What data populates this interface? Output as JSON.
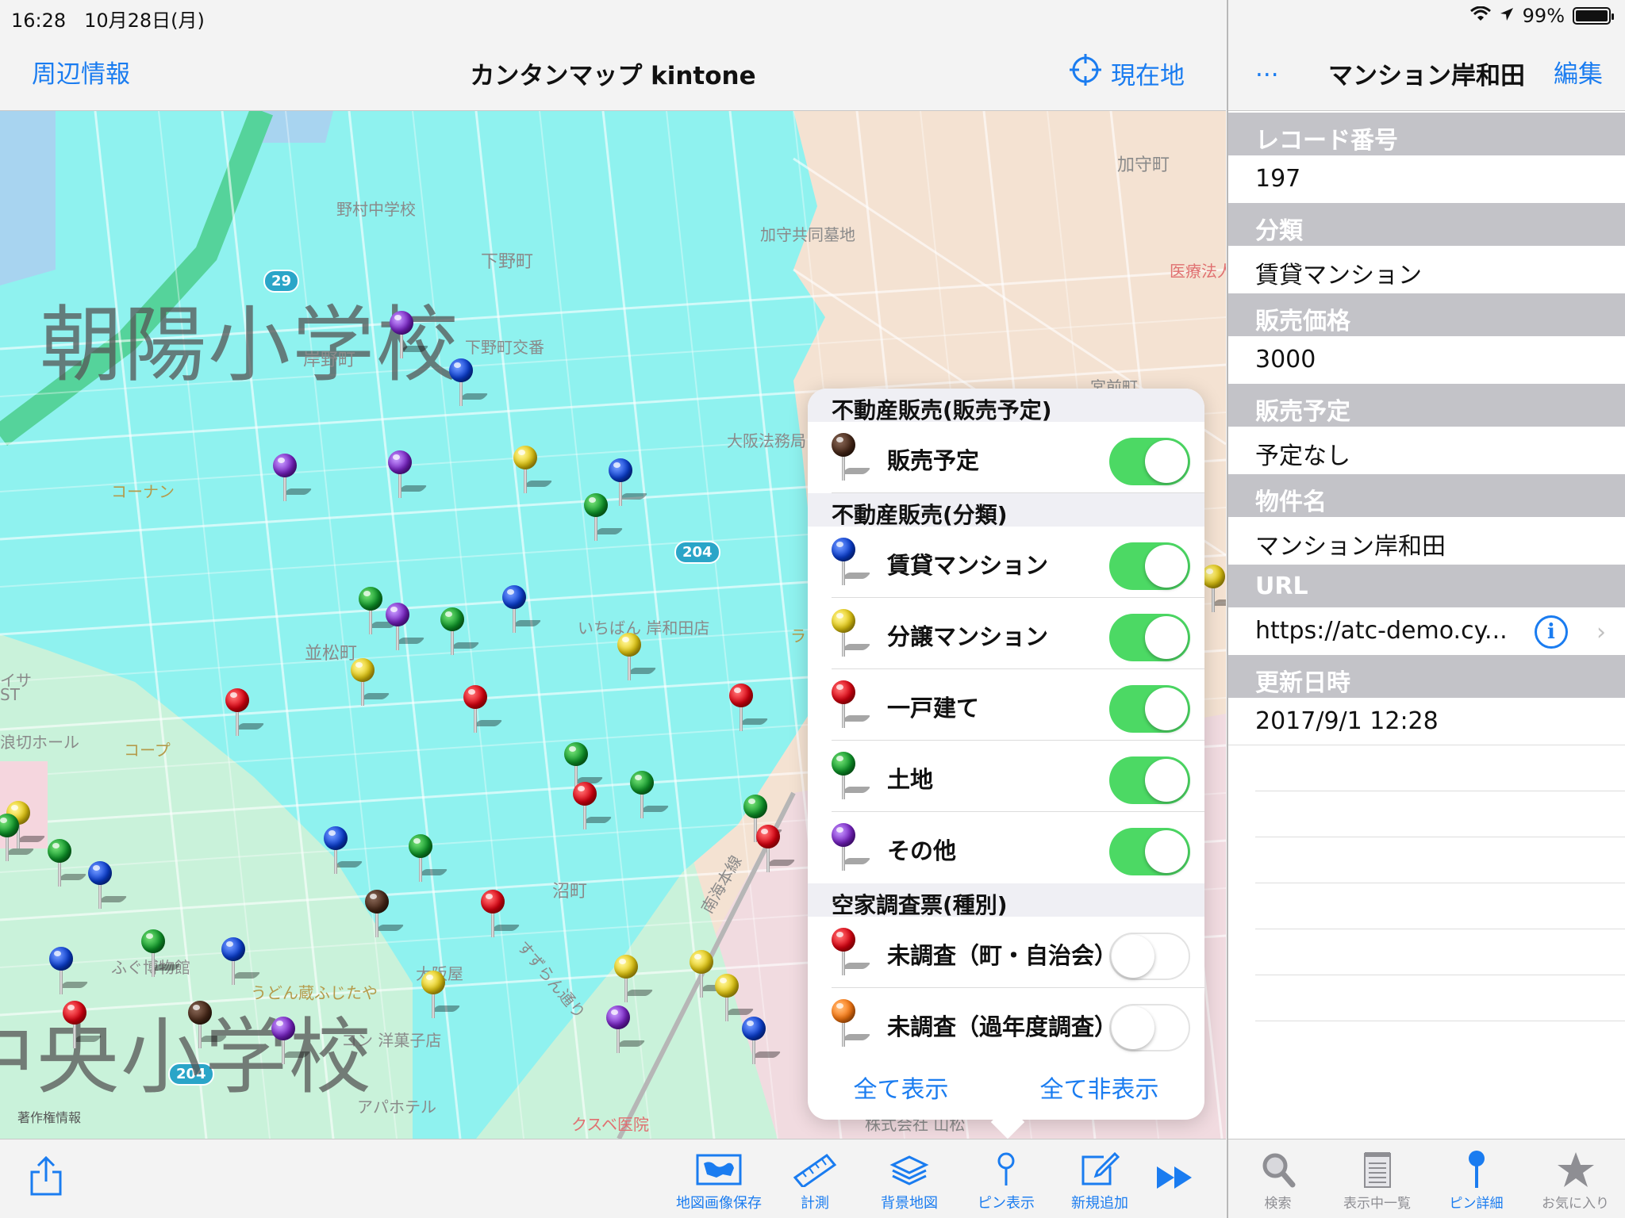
{
  "status": {
    "time": "16:28",
    "date": "10月28日(月)",
    "battery": "99%"
  },
  "nav": {
    "left": "周辺情報",
    "title": "カンタンマップ kintone",
    "right": "現在地"
  },
  "map": {
    "school1": "朝陽小学校",
    "school2": "中央小学校",
    "credit": "著作権情報",
    "labels": {
      "nomura": "野村中学校",
      "shimono": "下野町",
      "kishino": "岸野町",
      "shimono_koban": "下野町交番",
      "kami_cemetery": "加守共同墓地",
      "kamicho": "加守町",
      "iryo": "医療法人",
      "miyamae": "宮前町",
      "osaka_homu": "大阪法務局",
      "konan": "コーナン",
      "namimatsu": "並松町",
      "ichiban": "いちばん 岸和田店",
      "coop": "コープ",
      "namikiri": "浪切ホール",
      "numa": "沼町",
      "fugu": "ふぐ博物館",
      "udon": "うどん蔵ふじたや",
      "osakaya": "大阪屋",
      "yogashi": "コン 洋菓子店",
      "apa": "アパホテル",
      "kusube": "クスベ医院",
      "kabushiki": "株式会社 山松",
      "nankai": "南海本線",
      "isa": "イサ",
      "st": "ST",
      "ra": "ラ",
      "sudara": "すずらん通り"
    },
    "routes": {
      "r29": "29",
      "r204a": "204",
      "r204b": "204"
    }
  },
  "popover": {
    "sections": [
      {
        "title": "不動産販売(販売予定)",
        "items": [
          {
            "label": "販売予定",
            "color": "brown",
            "on": true
          }
        ]
      },
      {
        "title": "不動産販売(分類)",
        "items": [
          {
            "label": "賃貸マンション",
            "color": "blue",
            "on": true
          },
          {
            "label": "分譲マンション",
            "color": "yellow",
            "on": true
          },
          {
            "label": "一戸建て",
            "color": "red",
            "on": true
          },
          {
            "label": "土地",
            "color": "green",
            "on": true
          },
          {
            "label": "その他",
            "color": "purple",
            "on": true
          }
        ]
      },
      {
        "title": "空家調査票(種別)",
        "items": [
          {
            "label": "未調査（町・自治会）",
            "color": "red",
            "on": false
          },
          {
            "label": "未調査（過年度調査）",
            "color": "orange",
            "on": false
          }
        ]
      }
    ],
    "show_all": "全て表示",
    "hide_all": "全て非表示"
  },
  "toolbar": {
    "save_map": "地図画像保存",
    "measure": "計測",
    "background": "背景地図",
    "pin_display": "ピン表示",
    "add_new": "新規追加"
  },
  "detail": {
    "more": "...",
    "title": "マンション岸和田",
    "edit": "編集",
    "fields": [
      {
        "label": "レコード番号",
        "value": "197"
      },
      {
        "label": "分類",
        "value": "賃貸マンション"
      },
      {
        "label": "販売価格",
        "value": "3000"
      },
      {
        "label": "販売予定",
        "value": "予定なし"
      },
      {
        "label": "物件名",
        "value": "マンション岸和田"
      },
      {
        "label": "URL",
        "value": "https://atc-demo.cy..."
      },
      {
        "label": "更新日時",
        "value": "2017/9/1 12:28"
      }
    ]
  },
  "tabs": {
    "search": "検索",
    "list": "表示中一覧",
    "pin_detail": "ピン詳細",
    "favorites": "お気に入り"
  },
  "colors": {
    "accent": "#1a7cf0",
    "toggle_on": "#4cd964",
    "area_cyan": "#8ff2ef",
    "area_green": "#bff0d2"
  }
}
